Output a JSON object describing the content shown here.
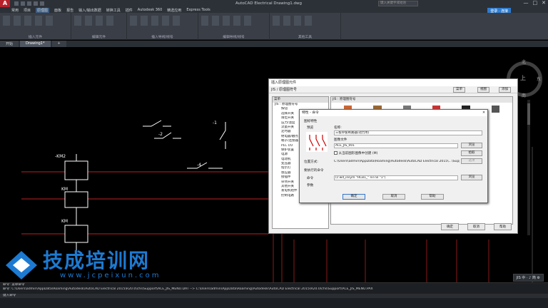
{
  "app": {
    "logo": "A",
    "title": "AutoCAD Electrical    Drawing1.dwg",
    "search_placeholder": "键入关键字或短语",
    "login": "登录 · 连接",
    "window_controls": [
      "—",
      "□",
      "✕"
    ]
  },
  "menubar": {
    "items": [
      "常用",
      "项目",
      "原理图",
      "面板",
      "报告",
      "输入/输出数据",
      "转换工具",
      "插件",
      "Autodesk 360",
      "精选应用",
      "Express Tools"
    ],
    "active_index": 2
  },
  "ribbon": {
    "groups": [
      "插入元件",
      "编辑元件",
      "插入导线/线号",
      "编辑导线/线号",
      "其他工具"
    ]
  },
  "doc_tabs": [
    "开始",
    "Drawing1*"
  ],
  "doc_tab_add": "+",
  "compass": {
    "north": "北",
    "south": "南",
    "east": "东",
    "west": "西",
    "center": "上"
  },
  "canvas_labels": {
    "km2": "-KM2",
    "km_a": "KM",
    "km_b": "KM",
    "s1": "-1",
    "s2": "-2",
    "s4": "-4"
  },
  "main_dialog": {
    "title": "插入原理图元件",
    "header": "JIS / 原理图符号",
    "breadcrumb": "JIS : 原理图符号",
    "buttons": {
      "menu": "菜单",
      "view": "视图",
      "add": "添加"
    },
    "tree_header": "菜单",
    "tree_items": [
      "JIS : 原理图符号",
      "按钮",
      "选择开关",
      "限位开关",
      "压力/温度",
      "流量开关",
      "定时器",
      "继电器/触点",
      "端子/连接器",
      "PLC I/O",
      "保护装置",
      "电源",
      "电动机",
      "变压器",
      "指示灯",
      "感应器",
      "接插件",
      "杂项开关",
      "其他开关",
      "发电机组件",
      "控制电路"
    ],
    "panel_header": "JIS : 原理图符号",
    "footer": {
      "ok": "确定",
      "cancel": "取消",
      "help": "帮助"
    }
  },
  "sub_dialog": {
    "title": "特性 - 命令",
    "close": "✕",
    "section_icon": "图标特性",
    "preview_label": "预览",
    "name_label": "名称:",
    "name_value": "三极单极断路器(动力用)",
    "image_file_label": "图像文件",
    "image_file_value": "ACE_JIS_001",
    "browse1": "浏览",
    "checkbox_label": "从当前图形图像中创建 (M)",
    "pick_btn": "拾取",
    "location_label": "位置方式:",
    "location_value": "C:\\Users\\admin\\AppData\\Roaming\\Autodesk\\AutoCAD Electrical 2015\\...\\Support",
    "options_btn": "选项",
    "command_section": "要执行的命令",
    "command_label": "命令",
    "command_value": "(c:wd_insym \"HCB1_\" nil nil \"1\")",
    "browse2": "浏览",
    "param_label": "参数",
    "ok": "确定",
    "cancel": "取消",
    "help": "帮助"
  },
  "command_line": {
    "lines": [
      "命令: 菜单命令",
      "命令: C:\\Users\\admin\\AppData\\Roaming\\Autodesk\\AutoCAD Electrical 2015\\R20.0\\chs\\Support\\ACE_JIS_MENU.DAT --> C:\\Users\\admin\\AppData\\Roaming\\Autodesk\\AutoCAD Electrical 2015\\R20.0\\chs\\Support\\ACE_JIS_MENU.PAX"
    ],
    "prompt": "键入命令"
  },
  "status_right": "JIS 中 · ♪ 简 ⚙",
  "watermark": {
    "text": "技成培训网",
    "url": "www.jcpeixun.com"
  },
  "colors": {
    "accent": "#2e7bcf",
    "redline": "#8b1a1a",
    "wire": "#c02020",
    "symbol": "#ffffff"
  }
}
